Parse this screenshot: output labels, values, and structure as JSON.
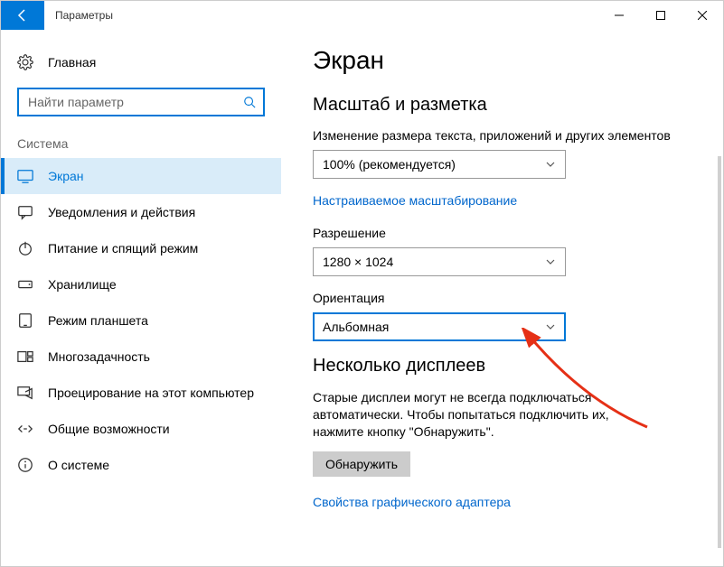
{
  "titlebar": {
    "title": "Параметры"
  },
  "sidebar": {
    "home": "Главная",
    "search_placeholder": "Найти параметр",
    "group": "Система",
    "items": [
      {
        "label": "Экран"
      },
      {
        "label": "Уведомления и действия"
      },
      {
        "label": "Питание и спящий режим"
      },
      {
        "label": "Хранилище"
      },
      {
        "label": "Режим планшета"
      },
      {
        "label": "Многозадачность"
      },
      {
        "label": "Проецирование на этот компьютер"
      },
      {
        "label": "Общие возможности"
      },
      {
        "label": "О системе"
      }
    ]
  },
  "main": {
    "heading": "Экран",
    "scale_heading": "Масштаб и разметка",
    "scale_label": "Изменение размера текста, приложений и других элементов",
    "scale_value": "100% (рекомендуется)",
    "custom_scaling_link": "Настраиваемое масштабирование",
    "resolution_label": "Разрешение",
    "resolution_value": "1280 × 1024",
    "orientation_label": "Ориентация",
    "orientation_value": "Альбомная",
    "multi_heading": "Несколько дисплеев",
    "multi_desc": "Старые дисплеи могут не всегда подключаться автоматически. Чтобы попытаться подключить их, нажмите кнопку \"Обнаружить\".",
    "detect_btn": "Обнаружить",
    "adapter_link": "Свойства графического адаптера"
  }
}
